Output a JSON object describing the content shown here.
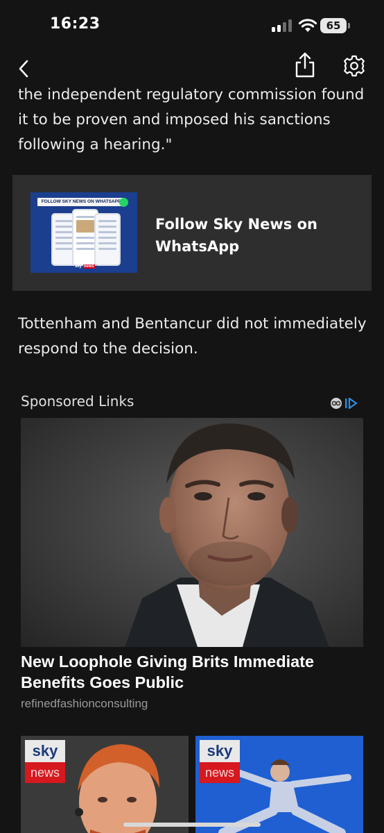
{
  "status_bar": {
    "time": "16:23",
    "battery_level": "65"
  },
  "nav": {
    "back_icon": "chevron-left-icon",
    "share_icon": "share-icon",
    "settings_icon": "gear-icon"
  },
  "article": {
    "paragraph_top": "the independent regulatory commission found it to be proven and imposed his sanctions following a hearing.\"",
    "paragraph_bottom": "Tottenham and Bentancur did not immediately respond to the decision."
  },
  "promo": {
    "title": "Follow Sky News on WhatsApp",
    "thumb_label": "FOLLOW SKY NEWS ON WHATSAPP",
    "thumb_logo_text": "sky",
    "thumb_logo_badge": "news"
  },
  "sponsored": {
    "header": "Sponsored Links",
    "adchoices_icon": "adchoices-icon",
    "ad": {
      "title": "New Loophole Giving Brits Immediate Benefits Goes Public",
      "source": "refinedfashionconsulting"
    },
    "thumbnails": [
      {
        "logo_top": "sky",
        "logo_bottom": "news"
      },
      {
        "logo_top": "sky",
        "logo_bottom": "news"
      }
    ]
  },
  "colors": {
    "background": "#141414",
    "card": "#2e2e2e",
    "sky_red": "#d6181f",
    "sky_blue": "#1f5fd1"
  }
}
